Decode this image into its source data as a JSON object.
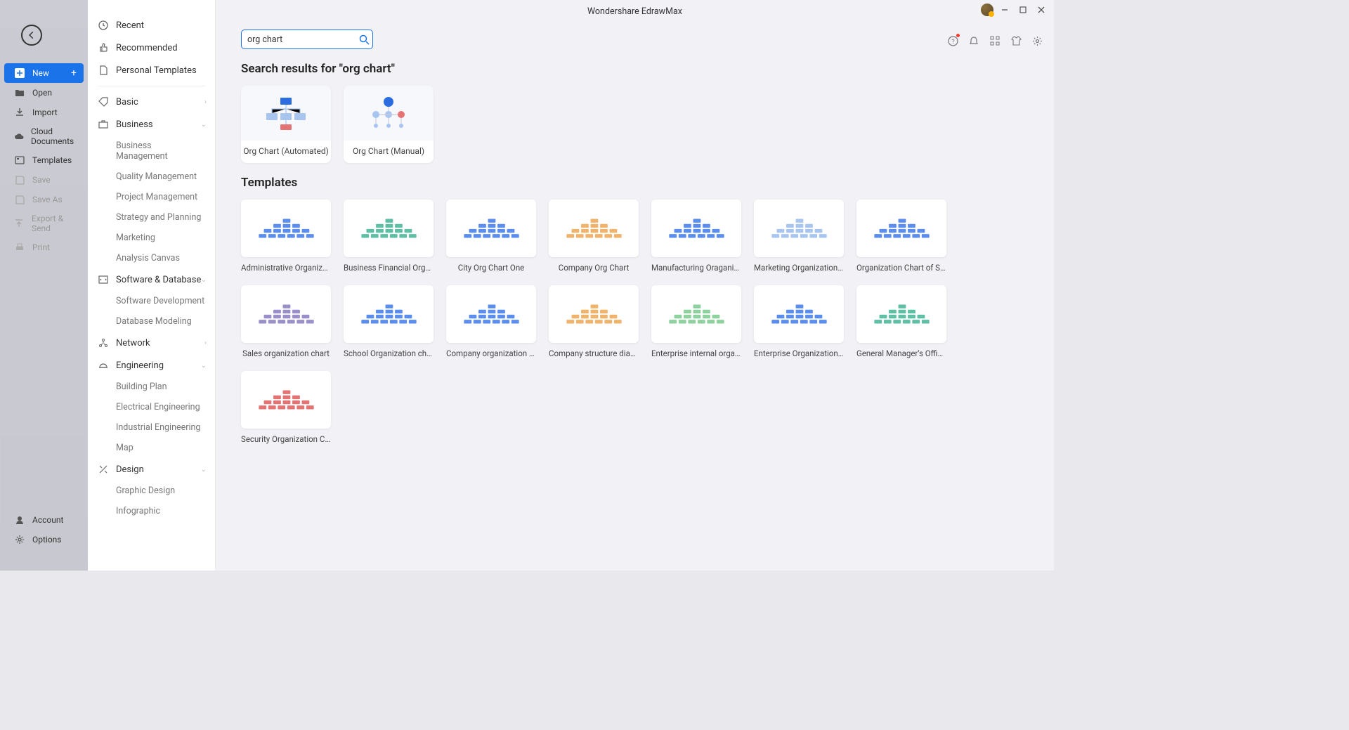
{
  "app_title": "Wondershare EdrawMax",
  "left_nav": {
    "new": "New",
    "open": "Open",
    "import": "Import",
    "cloud": "Cloud Documents",
    "templates": "Templates",
    "save": "Save",
    "save_as": "Save As",
    "export": "Export & Send",
    "print": "Print",
    "account": "Account",
    "options": "Options"
  },
  "categories": {
    "recent": "Recent",
    "recommended": "Recommended",
    "personal": "Personal Templates",
    "basic": "Basic",
    "business": "Business",
    "business_subs": [
      "Business Management",
      "Quality Management",
      "Project Management",
      "Strategy and Planning",
      "Marketing",
      "Analysis Canvas"
    ],
    "software": "Software & Database",
    "software_subs": [
      "Software Development",
      "Database Modeling"
    ],
    "network": "Network",
    "engineering": "Engineering",
    "engineering_subs": [
      "Building Plan",
      "Electrical Engineering",
      "Industrial Engineering",
      "Map"
    ],
    "design": "Design",
    "design_subs": [
      "Graphic Design",
      "Infographic"
    ]
  },
  "search": {
    "value": "org chart",
    "results_heading": "Search results for \"org chart\"",
    "results": [
      {
        "label": "Org Chart (Automated)"
      },
      {
        "label": "Org Chart (Manual)"
      }
    ]
  },
  "templates_heading": "Templates",
  "templates": [
    {
      "label": "Administrative Organizati...",
      "scheme": "blue"
    },
    {
      "label": "Business Financial Organiz...",
      "scheme": "teal"
    },
    {
      "label": "City Org Chart One",
      "scheme": "blue"
    },
    {
      "label": "Company Org Chart",
      "scheme": "orange"
    },
    {
      "label": "Manufacturing Oraganizati...",
      "scheme": "blue"
    },
    {
      "label": "Marketing Organization C...",
      "scheme": "lblue"
    },
    {
      "label": "Organization Chart of Sale...",
      "scheme": "blue"
    },
    {
      "label": "Sales organization chart",
      "scheme": "purple"
    },
    {
      "label": "School Organization chart",
      "scheme": "blue"
    },
    {
      "label": "Company organization chart",
      "scheme": "blue"
    },
    {
      "label": "Company structure diagram",
      "scheme": "orange"
    },
    {
      "label": "Enterprise internal organiz...",
      "scheme": "green"
    },
    {
      "label": "Enterprise Organization Ch...",
      "scheme": "blue"
    },
    {
      "label": "General Manager's Office ...",
      "scheme": "teal"
    },
    {
      "label": "Security Organization Chart",
      "scheme": "red"
    }
  ]
}
